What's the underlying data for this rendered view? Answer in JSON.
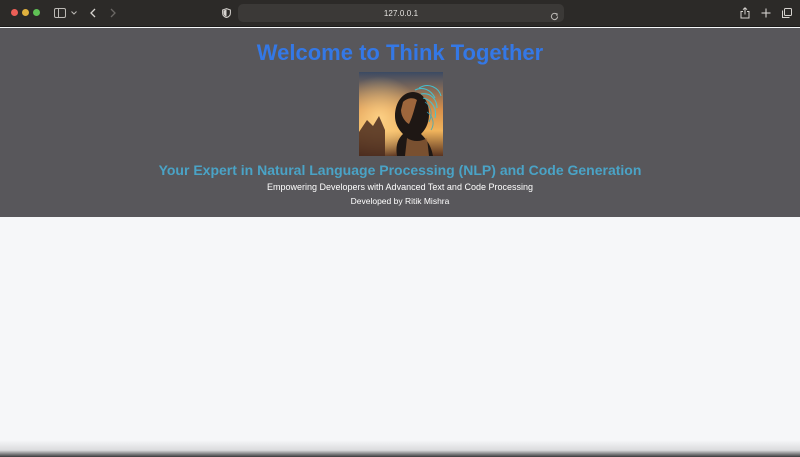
{
  "browser": {
    "url": "127.0.0.1",
    "icons": {
      "sidebar": "sidebar-icon",
      "back": "chevron-left-icon",
      "forward": "chevron-right-icon",
      "privacy": "shield-icon",
      "reload": "reload-icon",
      "share": "share-icon",
      "new_tab": "plus-icon",
      "tabs": "tabs-overview-icon"
    }
  },
  "hero": {
    "title": "Welcome to Think Together",
    "subtitle": "Your Expert in Natural Language Processing (NLP) and Code Generation",
    "tagline": "Empowering Developers with Advanced Text and Code Processing",
    "credit": "Developed by Ritik Mishra",
    "colors": {
      "background": "#58575b",
      "title": "#3478e6",
      "subtitle": "#4aa3c6"
    }
  }
}
